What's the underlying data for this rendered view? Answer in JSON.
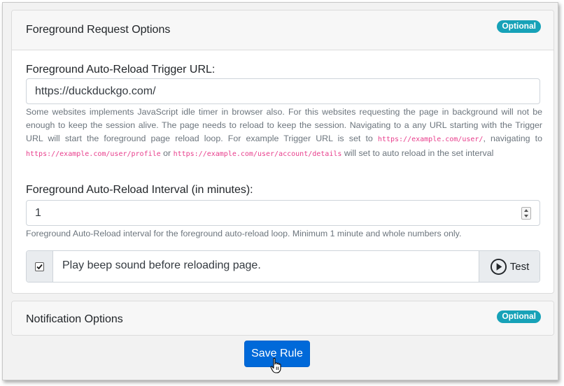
{
  "foreground_card": {
    "title": "Foreground Request Options",
    "badge": "Optional",
    "url_label": "Foreground Auto-Reload Trigger URL:",
    "url_value": "https://duckduckgo.com/",
    "url_help": {
      "text1": "Some websites implements JavaScript idle timer in browser also. For this websites requesting the page in background will not be enough to keep the session alive. The page needs to reload to keep the session. Navigating to a any URL starting with the Trigger URL will start the foreground page reload loop. For example Trigger URL is set to ",
      "code1": "https://example.com/user/",
      "text2": ", navigating to ",
      "code2": "https://example.com/user/profile",
      "text3": " or ",
      "code3": "https://example.com/user/account/details",
      "text4": " will set to auto reload in the set interval"
    },
    "interval_label": "Foreground Auto-Reload Interval (in minutes):",
    "interval_value": "1",
    "interval_help": "Foreground Auto-Reload interval for the foreground auto-reload loop. Minimum 1 minute and whole numbers only.",
    "beep_label": "Play beep sound before reloading page.",
    "beep_checked": true,
    "test_label": "Test"
  },
  "notification_card": {
    "title": "Notification Options",
    "badge": "Optional"
  },
  "save_label": "Save Rule",
  "colors": {
    "badge": "#17a2b8",
    "primary": "#0069d9",
    "code": "#e83e8c"
  }
}
